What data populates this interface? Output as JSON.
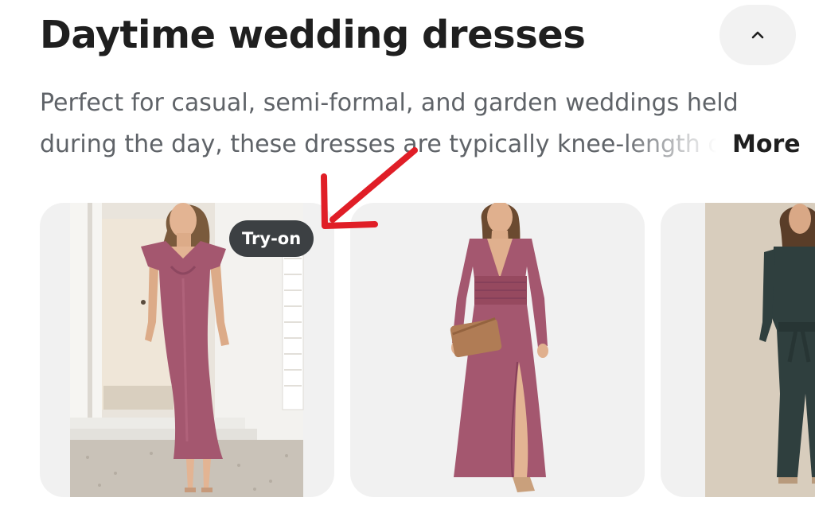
{
  "header": {
    "title": "Daytime wedding dresses",
    "collapse_icon": "chevron-up-icon"
  },
  "description": {
    "line1": "Perfect for casual, semi-formal, and garden weddings held",
    "line2": "during the day, these dresses are typically knee-length or",
    "more_label": "More"
  },
  "products": [
    {
      "badge": "Try-on",
      "image": "mauve-satin-flutter-sleeve-midi-dress"
    },
    {
      "image": "mauve-long-sleeve-v-neck-maxi-dress-with-clutch"
    },
    {
      "image": "dark-teal-wide-leg-jumpsuit"
    }
  ],
  "annotation": {
    "arrow_icon": "red-arrow-icon",
    "color": "#e01e27"
  },
  "colors": {
    "title": "#1f1f1f",
    "description": "#5f6368",
    "card_background": "#f1f1f1",
    "badge_background": "#3c4043",
    "dress_mauve": "#a4576f"
  }
}
